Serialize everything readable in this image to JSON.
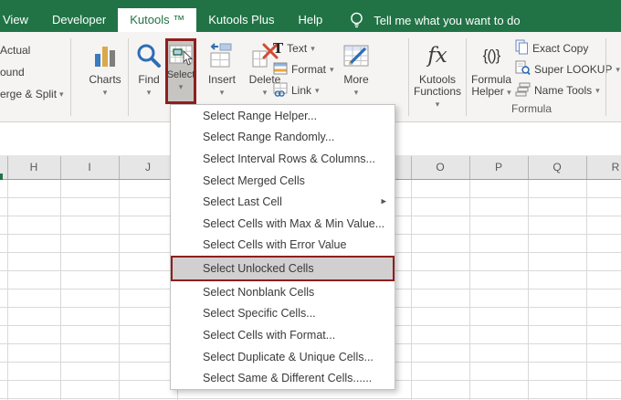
{
  "tab_bar": {
    "tabs": [
      {
        "label": "View",
        "active": false
      },
      {
        "label": "Developer",
        "active": false
      },
      {
        "label": "Kutools ™",
        "active": true
      },
      {
        "label": "Kutools Plus",
        "active": false
      },
      {
        "label": "Help",
        "active": false
      }
    ],
    "tell_me": "Tell me what you want to do"
  },
  "ribbon": {
    "clipped_left_items": [
      {
        "label": "Actual"
      },
      {
        "label": "ound"
      },
      {
        "label": "erge & Split",
        "has_dropdown": true
      }
    ],
    "buttons": {
      "charts": {
        "label": "Charts"
      },
      "find": {
        "label": "Find"
      },
      "select": {
        "label": "Select",
        "pressed": true,
        "annotated": true
      },
      "insert": {
        "label": "Insert"
      },
      "delete": {
        "label": "Delete"
      },
      "text": {
        "label": "Text"
      },
      "format": {
        "label": "Format"
      },
      "link": {
        "label": "Link"
      },
      "more": {
        "label": "More"
      },
      "kutools_functions": {
        "label_line1": "Kutools",
        "label_line2": "Functions"
      },
      "formula_helper": {
        "label_line1": "Formula",
        "label_line2": "Helper"
      },
      "exact_copy": {
        "label": "Exact Copy"
      },
      "super_lookup": {
        "label": "Super LOOKUP"
      },
      "name_tools": {
        "label": "Name Tools"
      }
    },
    "group_label": "Formula"
  },
  "menu": {
    "items": [
      {
        "label": "Select Range Helper..."
      },
      {
        "label": "Select Range Randomly..."
      },
      {
        "label": "Select Interval Rows & Columns..."
      },
      {
        "label": "Select Merged Cells"
      },
      {
        "label": "Select Last Cell",
        "has_submenu": true
      },
      {
        "label": "Select Cells with Max & Min Value..."
      },
      {
        "label": "Select Cells with Error Value"
      },
      {
        "label": "Select Unlocked Cells",
        "highlighted": true
      },
      {
        "label": "Select Nonblank Cells"
      },
      {
        "label": "Select Specific Cells..."
      },
      {
        "label": "Select Cells with Format..."
      },
      {
        "label": "Select Duplicate & Unique Cells..."
      },
      {
        "label": "Select Same & Different Cells......"
      }
    ]
  },
  "sheet": {
    "visible_columns_left": [
      "H",
      "I",
      "J"
    ],
    "visible_columns_right": [
      "O",
      "P",
      "Q",
      "R"
    ]
  },
  "icons": {
    "tell_me": "lightbulb",
    "charts": "bar-chart",
    "find": "magnifier",
    "select": "grid-with-cursor",
    "insert": "grid-with-arrow",
    "delete": "grid-with-red-x",
    "text": "serif-T",
    "format": "striped-grid",
    "link": "grid-with-chain",
    "more": "grid-with-pencil",
    "kutools_functions": "fx",
    "formula_helper": "curly-braces",
    "exact_copy": "two-documents",
    "super_lookup": "document-magnifier",
    "name_tools": "stacked-tags"
  },
  "colors": {
    "excel_green": "#217346",
    "annotation_red": "#8d1f1d",
    "menu_highlight_gray": "#d1cfcf",
    "pressed_button_gray": "#c7c5c2",
    "icon_blue": "#2e6db5",
    "icon_yellow": "#d9a94c"
  }
}
